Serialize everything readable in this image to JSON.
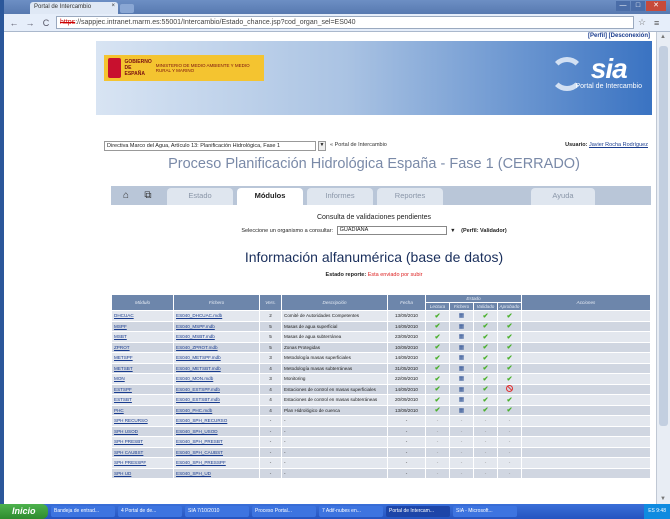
{
  "browser": {
    "tab_title": "Portal de Intercambio",
    "tab_close": "×",
    "url_scheme": "https",
    "url_rest": "://sappjec.intranet.marm.es:55001/Intercambio/Estado_chance.jsp?cod_organ_sel=ES040",
    "window_buttons": [
      "—",
      "□",
      "✕"
    ]
  },
  "top_links": "[Perfil] [Desconexión]",
  "banner": {
    "gov_text": "GOBIERNO DE ESPAÑA",
    "ministry_text": "MINISTERIO DE MEDIO AMBIENTE Y MEDIO RURAL Y MARINO",
    "logo_text": "sia",
    "logo_sub": "Portal de Intercambio"
  },
  "context": {
    "selected": "Directiva Marco del Agua, Artículo 13: Planificación Hidrológica, Fase 1",
    "portal_label": "« Portal de Intercambio",
    "user_label": "Usuario:",
    "user_name": "Javier Rocha Rodríguez"
  },
  "process_title": "Proceso Planificación Hidrológica España - Fase 1 (CERRADO)",
  "nav": {
    "tabs": [
      "Estado",
      "Módulos",
      "Informes",
      "Reportes",
      "Ayuda"
    ],
    "active": "Módulos"
  },
  "consulta": {
    "title": "Consulta de validaciones pendientes",
    "select_label": "Seleccione un organismo a consultar:",
    "organismo": "GUADIANA",
    "perfil": "(Perfil: Validador)"
  },
  "info_title": "Información alfanumérica (base de datos)",
  "estado_reporte": {
    "label": "Estado reporte:",
    "value": "Esta enviado por subir"
  },
  "table": {
    "headers": [
      "Módulo",
      "Fichero",
      "Vers.",
      "Descripción",
      "Fecha",
      "Estado",
      "Acciones"
    ],
    "sub_headers": [
      "Lectura",
      "Fichero",
      "Validado",
      "Aprobado"
    ],
    "rows": [
      {
        "modulo": "DHCUAC",
        "fichero": "ES040_DHCUAC.mdb",
        "vers": "2",
        "desc": "Comité de Autoridades Competentes",
        "fecha": "13/09/2010",
        "s": [
          "ok",
          "grid",
          "ok",
          "ok"
        ]
      },
      {
        "modulo": "MSPF",
        "fichero": "ES040_MSPF.mdb",
        "vers": "5",
        "desc": "Masas de agua superficial",
        "fecha": "14/09/2010",
        "s": [
          "ok",
          "grid",
          "ok",
          "ok"
        ]
      },
      {
        "modulo": "MSBT",
        "fichero": "ES040_MSBT.mdb",
        "vers": "5",
        "desc": "Masas de agua subterránea",
        "fecha": "23/09/2010",
        "s": [
          "ok",
          "grid",
          "ok",
          "ok"
        ]
      },
      {
        "modulo": "ZPROT",
        "fichero": "ES040_ZPROT.mdb",
        "vers": "5",
        "desc": "Zonas Protegidas",
        "fecha": "10/09/2010",
        "s": [
          "ok",
          "grid",
          "ok",
          "ok"
        ]
      },
      {
        "modulo": "METSPF",
        "fichero": "ES040_METSPF.mdb",
        "vers": "3",
        "desc": "Metodología masas superficiales",
        "fecha": "14/09/2010",
        "s": [
          "ok",
          "grid",
          "ok",
          "ok"
        ]
      },
      {
        "modulo": "METSBT",
        "fichero": "ES040_METSBT.mdb",
        "vers": "4",
        "desc": "Metodología masas subterráneas",
        "fecha": "31/05/2010",
        "s": [
          "ok",
          "grid",
          "ok",
          "ok"
        ]
      },
      {
        "modulo": "MON",
        "fichero": "ES040_MON.mdb",
        "vers": "3",
        "desc": "Monitoring",
        "fecha": "22/09/2010",
        "s": [
          "ok",
          "grid",
          "ok",
          "ok"
        ]
      },
      {
        "modulo": "ESTSPF",
        "fichero": "ES040_ESTSPF.mdb",
        "vers": "4",
        "desc": "Estaciones de control en masas superficiales",
        "fecha": "14/09/2010",
        "s": [
          "ok",
          "grid",
          "ok",
          "no"
        ]
      },
      {
        "modulo": "ESTSBT",
        "fichero": "ES040_ESTSBT.mdb",
        "vers": "4",
        "desc": "Estaciones de control en masas subterráneas",
        "fecha": "20/09/2010",
        "s": [
          "ok",
          "grid",
          "ok",
          "ok"
        ]
      },
      {
        "modulo": "PHC",
        "fichero": "ES040_PHC.mdb",
        "vers": "4",
        "desc": "Plan Hidrológico de cuenca",
        "fecha": "13/09/2010",
        "s": [
          "ok",
          "grid",
          "ok",
          "ok"
        ]
      },
      {
        "modulo": "SPH RECURSO",
        "fichero": "ES040_SPH_RECURSO",
        "vers": "-",
        "desc": "-",
        "fecha": "-",
        "s": [
          "-",
          "-",
          "-",
          "-"
        ]
      },
      {
        "modulo": "SPH USOD",
        "fichero": "ES040_SPH_USOD",
        "vers": "-",
        "desc": "-",
        "fecha": "-",
        "s": [
          "-",
          "-",
          "-",
          "-"
        ]
      },
      {
        "modulo": "SPH PRESBT",
        "fichero": "ES040_SPH_PRESBT",
        "vers": "-",
        "desc": "-",
        "fecha": "-",
        "s": [
          "-",
          "-",
          "-",
          "-"
        ]
      },
      {
        "modulo": "SPH CAUBST",
        "fichero": "ES040_SPH_CAUBST",
        "vers": "-",
        "desc": "-",
        "fecha": "-",
        "s": [
          "-",
          "-",
          "-",
          "-"
        ]
      },
      {
        "modulo": "SPH PRESSPF",
        "fichero": "ES040_SPH_PRESSPF",
        "vers": "-",
        "desc": "-",
        "fecha": "-",
        "s": [
          "-",
          "-",
          "-",
          "-"
        ]
      },
      {
        "modulo": "SPH UD",
        "fichero": "ES040_SPH_UD",
        "vers": "-",
        "desc": "-",
        "fecha": "-",
        "s": [
          "-",
          "-",
          "-",
          "-"
        ]
      }
    ]
  },
  "taskbar": {
    "start": "Inicio",
    "items": [
      "Bandeja de entrad...",
      "4 Portal de de...",
      "SIA 7/10/2010",
      "Proceso Portal...",
      "7 Adif-nubes en...",
      "Portal de Intercam...",
      "SIA - Microsoft..."
    ],
    "tray": "ES  9:48"
  }
}
